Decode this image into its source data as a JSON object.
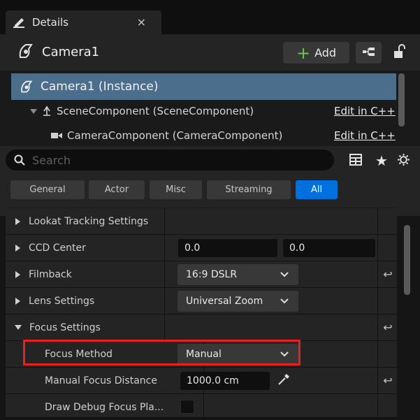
{
  "tab": {
    "title": "Details",
    "close": "×"
  },
  "header": {
    "actor_name": "Camera1",
    "add_label": "Add"
  },
  "components": {
    "instance": "Camera1 (Instance)",
    "items": [
      {
        "label": "SceneComponent (SceneComponent)",
        "action": "Edit in C++"
      },
      {
        "label": "CameraComponent (CameraComponent)",
        "action": "Edit in C++"
      }
    ]
  },
  "search": {
    "placeholder": "Search"
  },
  "filters": [
    "General",
    "Actor",
    "Misc",
    "Streaming",
    "All"
  ],
  "filters_active": "All",
  "properties": [
    {
      "name": "Lookat Tracking Settings"
    },
    {
      "name": "CCD Center",
      "x": "0.0",
      "y": "0.0"
    },
    {
      "name": "Filmback",
      "value": "16:9 DSLR"
    },
    {
      "name": "Lens Settings",
      "value": "Universal Zoom"
    },
    {
      "name": "Focus Settings"
    },
    {
      "name": "Focus Method",
      "value": "Manual"
    },
    {
      "name": "Manual Focus Distance",
      "value": "1000.0 cm"
    },
    {
      "name": "Draw Debug Focus Pla..."
    }
  ],
  "colors": {
    "accent": "#0070e0",
    "selection": "#4c6e8d",
    "highlight": "#e8201f",
    "add_plus": "#5fc94a"
  }
}
